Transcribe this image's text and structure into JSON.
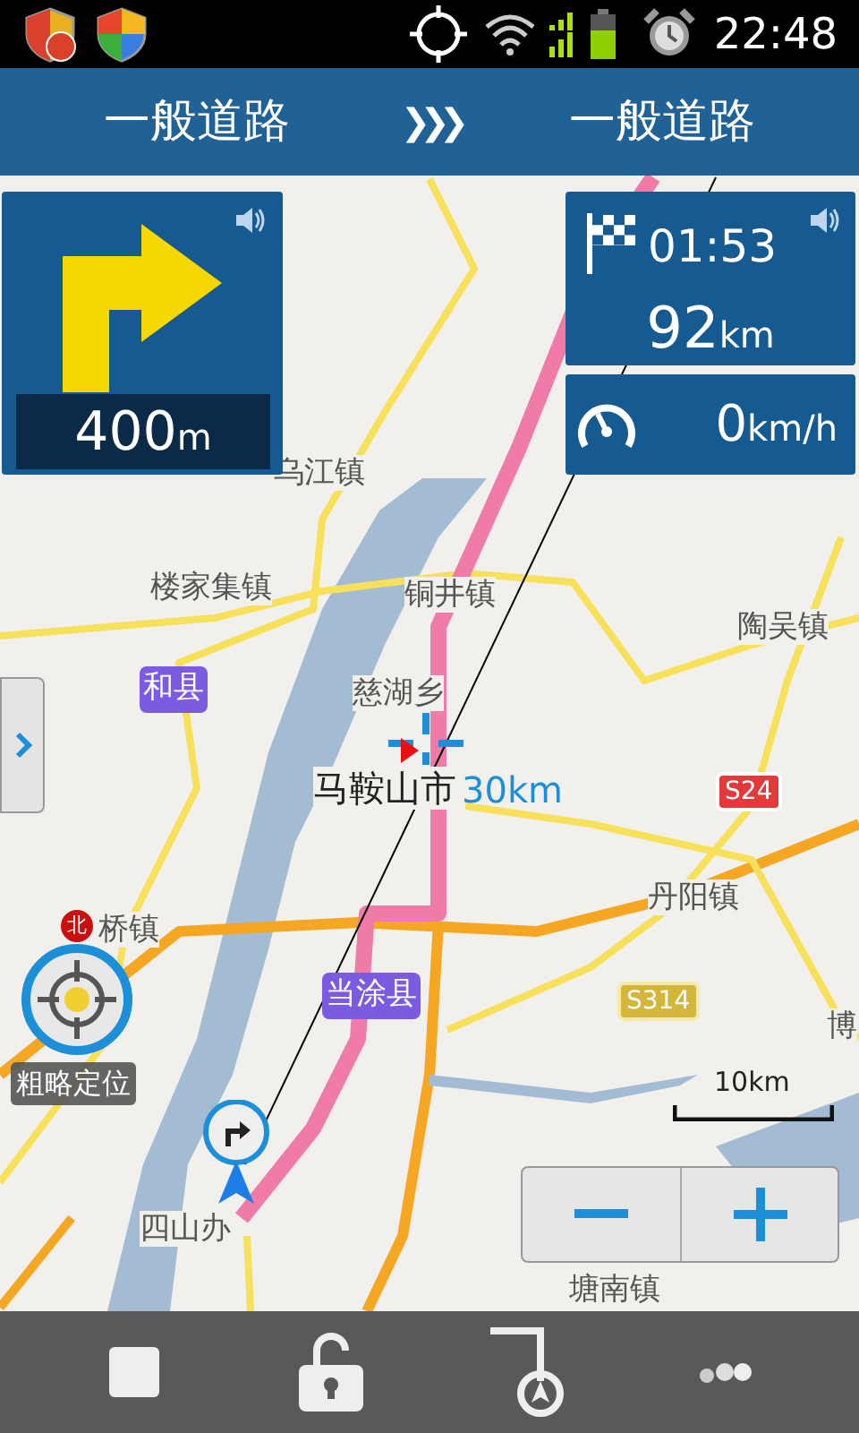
{
  "status_bar": {
    "time": "22:48"
  },
  "guidance": {
    "current_road": "一般道路",
    "separator": "❯❯❯",
    "next_road": "一般道路",
    "distance": "400",
    "distance_unit": "m"
  },
  "trip": {
    "time": "01:53",
    "distance": "92",
    "distance_unit": "km"
  },
  "speed": {
    "value": "0",
    "unit": "km/h"
  },
  "map": {
    "labels": [
      {
        "text": "乌江镇",
        "kind": "town"
      },
      {
        "text": "楼家集镇",
        "kind": "town"
      },
      {
        "text": "和县",
        "kind": "county"
      },
      {
        "text": "铜井镇",
        "kind": "town"
      },
      {
        "text": "陶吴镇",
        "kind": "town"
      },
      {
        "text": "慈湖乡",
        "kind": "town"
      },
      {
        "text": "马鞍山市",
        "kind": "city"
      },
      {
        "text": "S24",
        "kind": "provincial_road"
      },
      {
        "text": "丹阳镇",
        "kind": "town"
      },
      {
        "text": "桥镇",
        "kind": "town"
      },
      {
        "text": "当涂县",
        "kind": "county"
      },
      {
        "text": "S314",
        "kind": "county_road"
      },
      {
        "text": "博",
        "kind": "town"
      },
      {
        "text": "四山办",
        "kind": "town"
      },
      {
        "text": "塘南镇",
        "kind": "town"
      }
    ],
    "cursor_distance": "30km",
    "scale": "10km",
    "compass": "北",
    "locate_label": "粗略定位"
  }
}
